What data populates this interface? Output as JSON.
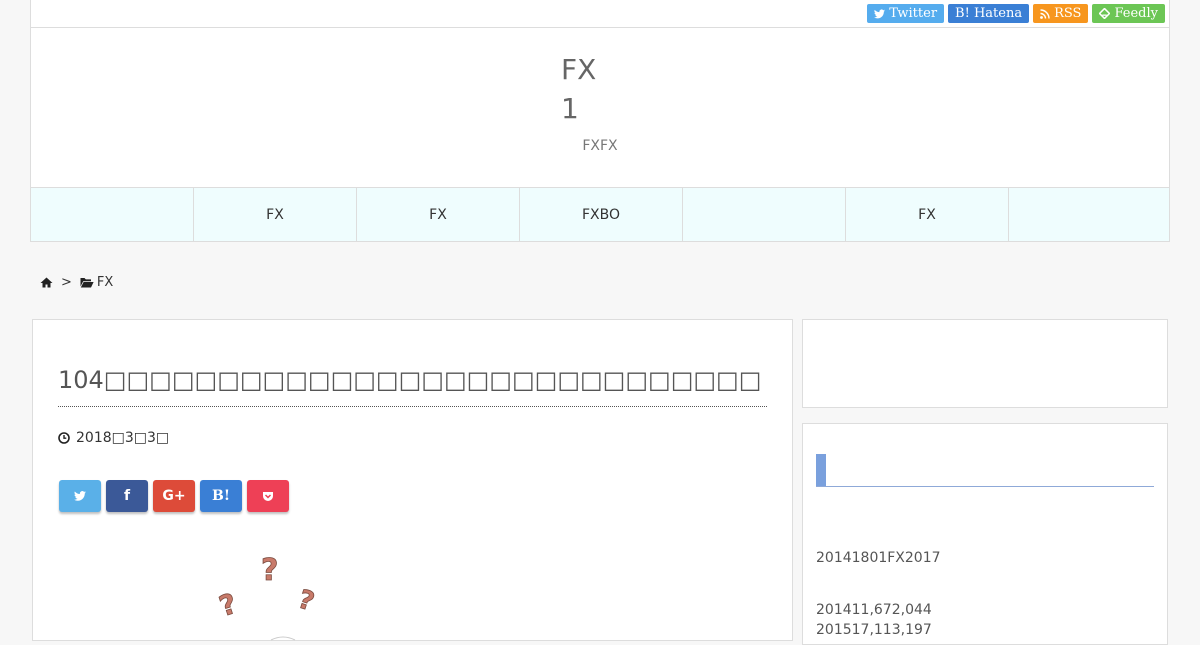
{
  "social": [
    {
      "label": "Twitter",
      "icon": "twitter-icon",
      "color": "#55acee"
    },
    {
      "label": "B! Hatena",
      "icon": "",
      "color": "#3a7fd5"
    },
    {
      "label": "RSS",
      "icon": "rss-icon",
      "color": "#f7961e"
    },
    {
      "label": "Feedly",
      "icon": "feedly-icon",
      "color": "#6cc655"
    }
  ],
  "header": {
    "title_line1": "FX",
    "title_line2": "1",
    "tagline": "FXFX"
  },
  "nav": [
    "",
    "FX",
    "FX",
    "FXBO",
    "",
    "FX",
    ""
  ],
  "breadcrumb": {
    "separator": ">",
    "category": "FX"
  },
  "post": {
    "title": "104□□□□□□□□□□□□□□□□□□□□□□□□□□□□□",
    "date": "2018□3□3□"
  },
  "share_buttons": [
    {
      "name": "twitter",
      "label": "",
      "color": "#5ab0e8"
    },
    {
      "name": "facebook",
      "label": "f",
      "color": "#3b5998"
    },
    {
      "name": "googleplus",
      "label": "G+",
      "color": "#dd4b39"
    },
    {
      "name": "hatena",
      "label": "B!",
      "color": "#3a7fd5"
    },
    {
      "name": "pocket",
      "label": "",
      "color": "#ee4056"
    }
  ],
  "sidebar": {
    "text1": "20141801FX2017",
    "text2": "201411,672,044",
    "text3": "201517,113,197"
  }
}
